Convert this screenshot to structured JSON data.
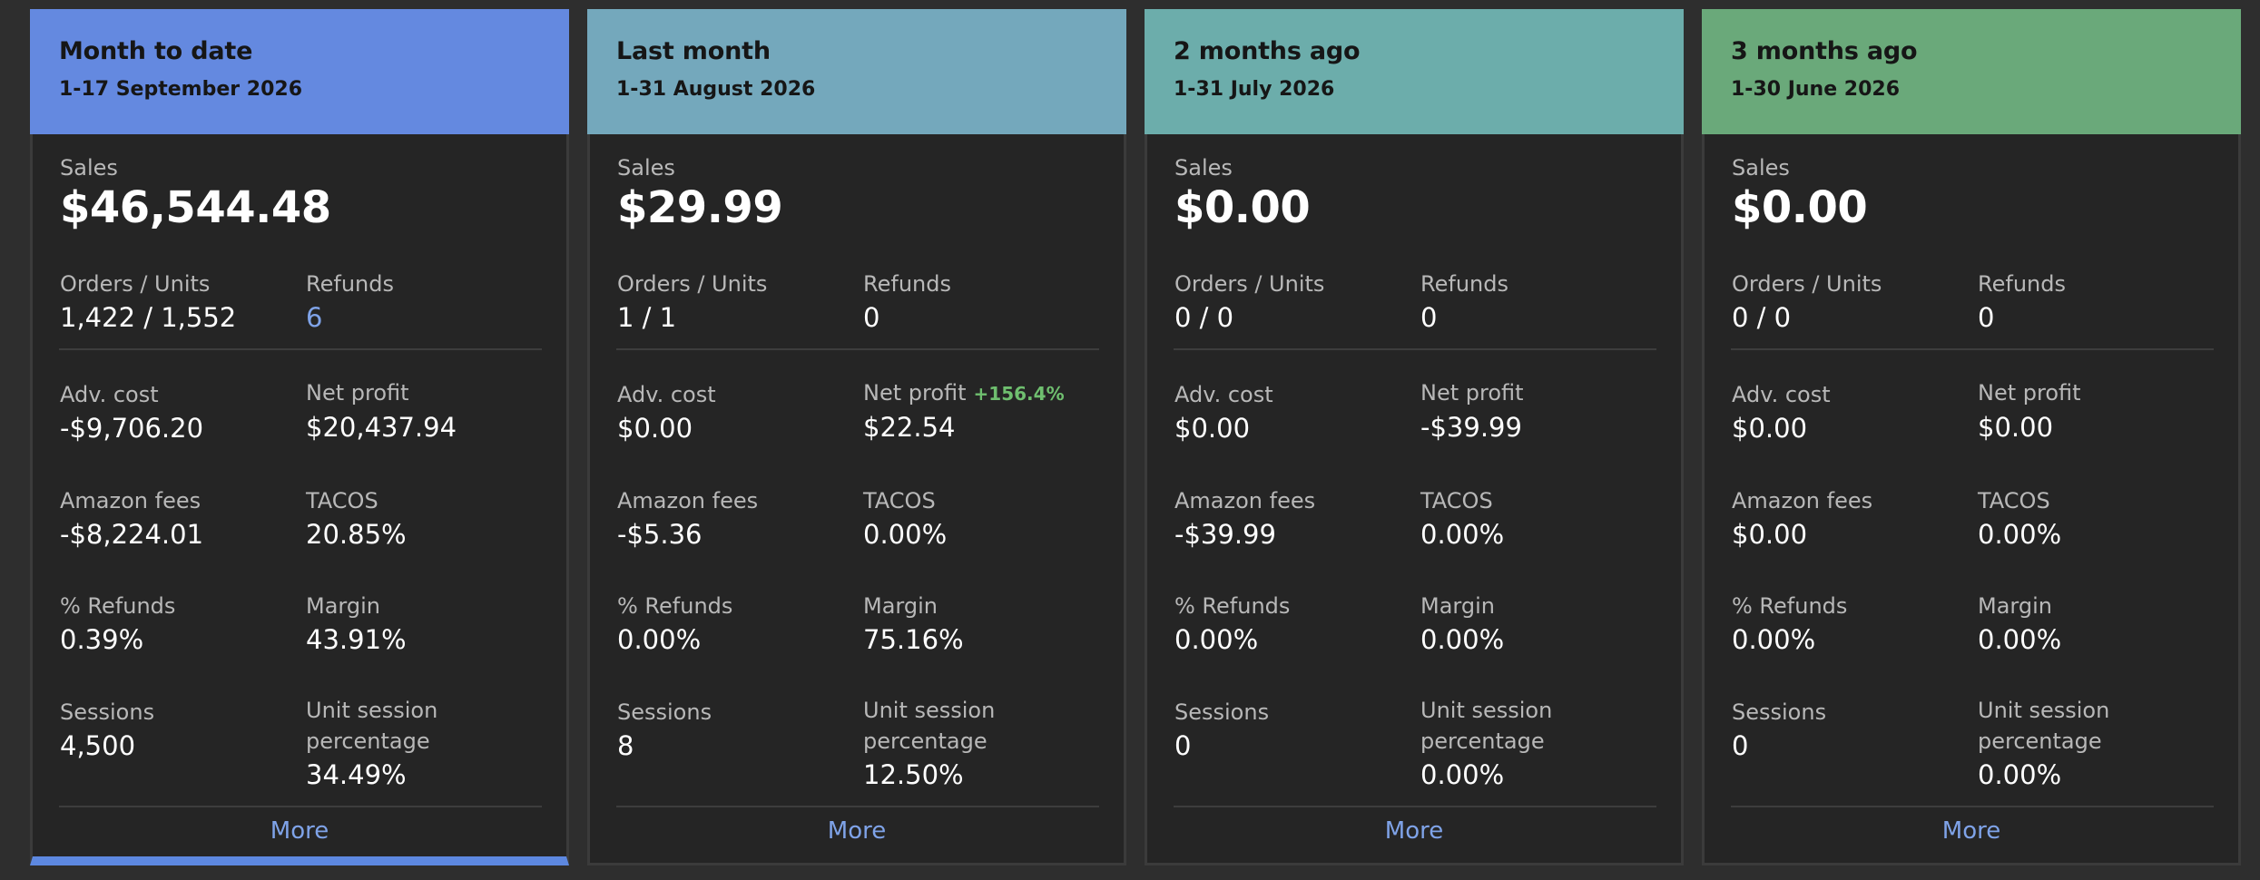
{
  "cards": [
    {
      "title": "Month to date",
      "date": "1-17 September 2026",
      "header_color": "#6489e0",
      "sales_label": "Sales",
      "sales": "$46,544.48",
      "orders_label": "Orders / Units",
      "orders": "1,422 / 1,552",
      "refunds_label": "Refunds",
      "refunds": "6",
      "adv_cost_label": "Adv. cost",
      "adv_cost": "-$9,706.20",
      "net_profit_label": "Net profit",
      "net_profit_change": "",
      "net_profit": "$20,437.94",
      "amazon_fees_label": "Amazon fees",
      "amazon_fees": "-$8,224.01",
      "tacos_label": "TACOS",
      "tacos": "20.85%",
      "pct_refunds_label": "% Refunds",
      "pct_refunds": "0.39%",
      "margin_label": "Margin",
      "margin": "43.91%",
      "sessions_label": "Sessions",
      "sessions": "4,500",
      "unit_session_label_1": "Unit session",
      "unit_session_label_2": "percentage",
      "unit_session": "34.49%",
      "more_label": "More"
    },
    {
      "title": "Last month",
      "date": "1-31 August 2026",
      "header_color": "#74a8bc",
      "sales_label": "Sales",
      "sales": "$29.99",
      "orders_label": "Orders / Units",
      "orders": "1 / 1",
      "refunds_label": "Refunds",
      "refunds": "0",
      "adv_cost_label": "Adv. cost",
      "adv_cost": "$0.00",
      "net_profit_label": "Net profit",
      "net_profit_change": "+156.4%",
      "net_profit": "$22.54",
      "amazon_fees_label": "Amazon fees",
      "amazon_fees": "-$5.36",
      "tacos_label": "TACOS",
      "tacos": "0.00%",
      "pct_refunds_label": "% Refunds",
      "pct_refunds": "0.00%",
      "margin_label": "Margin",
      "margin": "75.16%",
      "sessions_label": "Sessions",
      "sessions": "8",
      "unit_session_label_1": "Unit session",
      "unit_session_label_2": "percentage",
      "unit_session": "12.50%",
      "more_label": "More"
    },
    {
      "title": "2 months ago",
      "date": "1-31 July 2026",
      "header_color": "#6cadab",
      "sales_label": "Sales",
      "sales": "$0.00",
      "orders_label": "Orders / Units",
      "orders": "0 / 0",
      "refunds_label": "Refunds",
      "refunds": "0",
      "adv_cost_label": "Adv. cost",
      "adv_cost": "$0.00",
      "net_profit_label": "Net profit",
      "net_profit_change": "",
      "net_profit": "-$39.99",
      "amazon_fees_label": "Amazon fees",
      "amazon_fees": "-$39.99",
      "tacos_label": "TACOS",
      "tacos": "0.00%",
      "pct_refunds_label": "% Refunds",
      "pct_refunds": "0.00%",
      "margin_label": "Margin",
      "margin": "0.00%",
      "sessions_label": "Sessions",
      "sessions": "0",
      "unit_session_label_1": "Unit session",
      "unit_session_label_2": "percentage",
      "unit_session": "0.00%",
      "more_label": "More"
    },
    {
      "title": "3 months ago",
      "date": "1-30 June 2026",
      "header_color": "#6aa97a",
      "sales_label": "Sales",
      "sales": "$0.00",
      "orders_label": "Orders / Units",
      "orders": "0 / 0",
      "refunds_label": "Refunds",
      "refunds": "0",
      "adv_cost_label": "Adv. cost",
      "adv_cost": "$0.00",
      "net_profit_label": "Net profit",
      "net_profit_change": "",
      "net_profit": "$0.00",
      "amazon_fees_label": "Amazon fees",
      "amazon_fees": "$0.00",
      "tacos_label": "TACOS",
      "tacos": "0.00%",
      "pct_refunds_label": "% Refunds",
      "pct_refunds": "0.00%",
      "margin_label": "Margin",
      "margin": "0.00%",
      "sessions_label": "Sessions",
      "sessions": "0",
      "unit_session_label_1": "Unit session",
      "unit_session_label_2": "percentage",
      "unit_session": "0.00%",
      "more_label": "More"
    }
  ],
  "theme": {
    "active_accent": "#5d88e0",
    "link_color": "#7fa3e8",
    "positive_change_color": "#6fbf6f"
  }
}
